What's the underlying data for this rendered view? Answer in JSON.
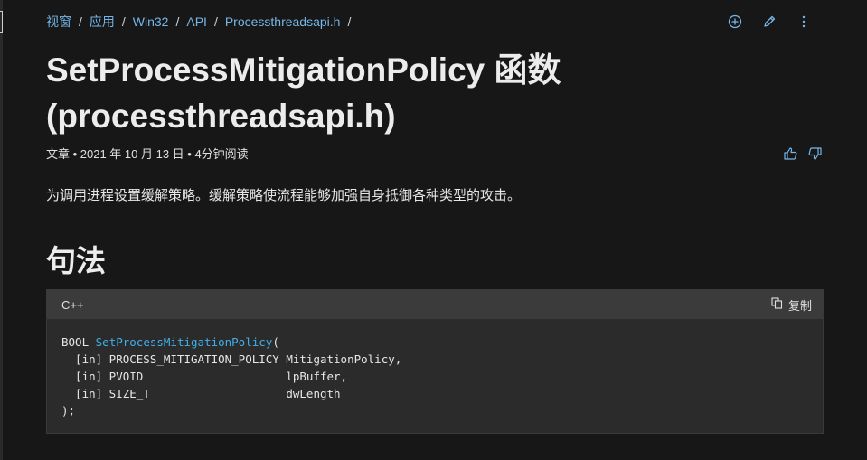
{
  "breadcrumb": [
    "视窗",
    "应用",
    "Win32",
    "API",
    "Processthreadsapi.h"
  ],
  "breadcrumb_sep": "/",
  "toolbar_icons": [
    "add-icon",
    "edit-icon",
    "more-icon"
  ],
  "title_line1": "SetProcessMitigationPolicy 函数",
  "title_line2": "(processthreadsapi.h)",
  "meta": "文章 • 2021 年 10 月 13 日 • 4分钟阅读",
  "feedback_icons": [
    "thumbs-up-icon",
    "thumbs-down-icon"
  ],
  "intro": "为调用进程设置缓解策略。缓解策略使流程能够加强自身抵御各种类型的攻击。",
  "section_heading": "句法",
  "code": {
    "language": "C++",
    "copy_label": "复制",
    "keyword": "BOOL",
    "function_name": "SetProcessMitigationPolicy",
    "open_paren": "(",
    "params": [
      "  [in] PROCESS_MITIGATION_POLICY MitigationPolicy,",
      "  [in] PVOID                     lpBuffer,",
      "  [in] SIZE_T                    dwLength"
    ],
    "close": ");"
  },
  "colors": {
    "link": "#75b6e7",
    "function": "#3fb0e8",
    "background": "#171717"
  }
}
